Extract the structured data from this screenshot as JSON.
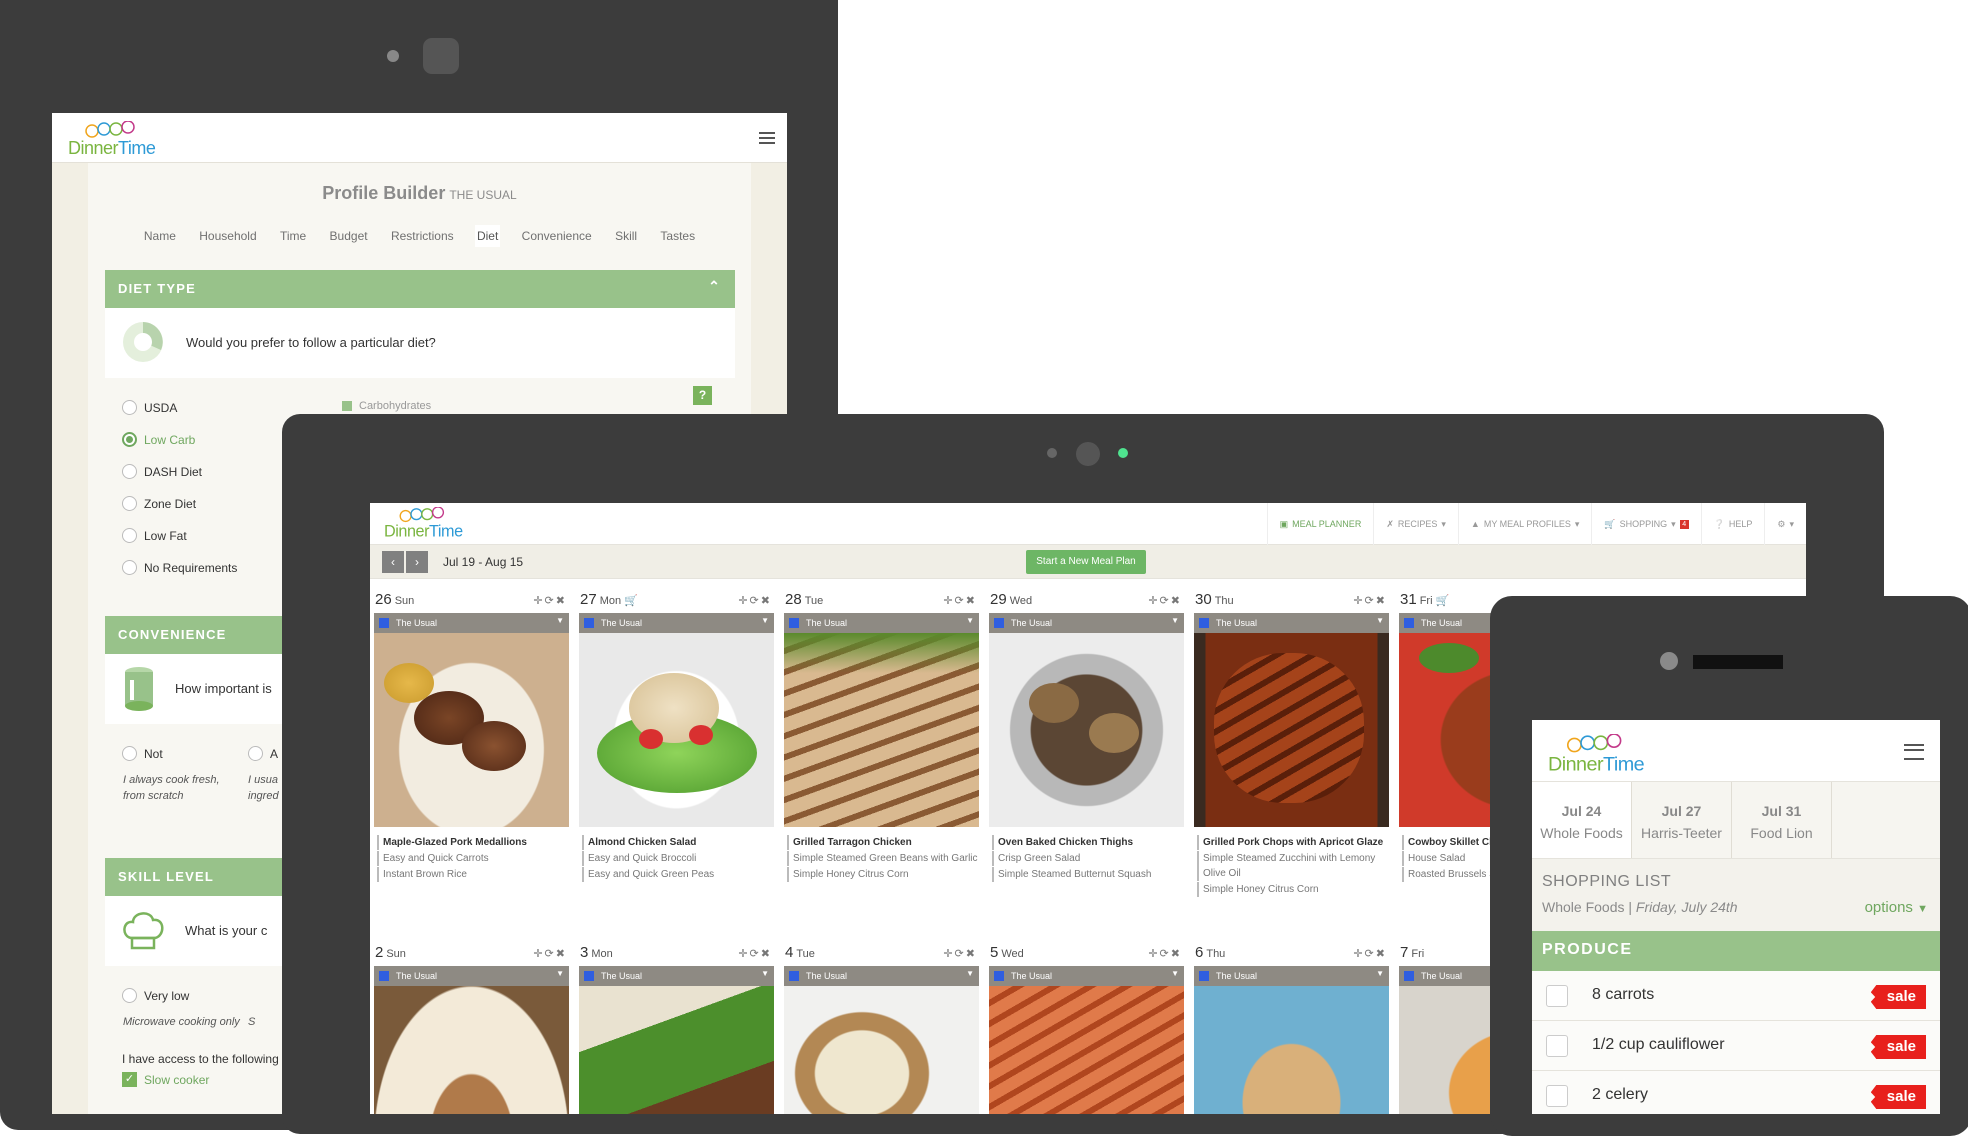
{
  "colors": {
    "brand_green": "#6fa75f",
    "section_green": "#98c28a",
    "sale_red": "#e8201c",
    "profile_blue": "#2f5ee0"
  },
  "logo": {
    "part1": "Dinner",
    "part2": "Time"
  },
  "tablet": {
    "title": "Profile Builder",
    "subtitle": "THE USUAL",
    "tabs": [
      "Name",
      "Household",
      "Time",
      "Budget",
      "Restrictions",
      "Diet",
      "Convenience",
      "Skill",
      "Tastes"
    ],
    "active_tab": "Diet",
    "diet": {
      "header": "DIET TYPE",
      "question": "Would you prefer to follow a particular diet?",
      "help": "?",
      "chart_label": "Carbohydrates",
      "options": [
        "USDA",
        "Low Carb",
        "DASH Diet",
        "Zone Diet",
        "Low Fat",
        "No Requirements"
      ],
      "selected": "Low Carb"
    },
    "convenience": {
      "header": "CONVENIENCE",
      "question": "How important is",
      "opt1": "Not",
      "opt2": "A",
      "note1a": "I always cook fresh,",
      "note1b": "from scratch",
      "note2a": "I usua",
      "note2b": "ingred"
    },
    "skill": {
      "header": "SKILL LEVEL",
      "question": "What is your c",
      "opt1": "Very low",
      "note1": "Microwave cooking only",
      "note2": "S",
      "access": "I have access to the following",
      "slow": "Slow cooker"
    }
  },
  "laptop": {
    "menu": [
      "MEAL PLANNER",
      "RECIPES",
      "MY MEAL PROFILES",
      "SHOPPING",
      "HELP"
    ],
    "shopping_badge": "4",
    "date_range": "Jul 19 - Aug 15",
    "new_plan": "Start a New Meal Plan",
    "profile_name": "The Usual",
    "week1": [
      {
        "num": "26",
        "dow": "Sun",
        "main": "Maple-Glazed Pork Medallions",
        "sides": [
          "Easy and Quick Carrots",
          "Instant Brown Rice"
        ]
      },
      {
        "num": "27",
        "dow": "Mon",
        "main": "Almond Chicken Salad",
        "sides": [
          "Easy and Quick Broccoli",
          "Easy and Quick Green Peas"
        ]
      },
      {
        "num": "28",
        "dow": "Tue",
        "main": "Grilled Tarragon Chicken",
        "sides": [
          "Simple Steamed Green Beans with Garlic",
          "Simple Honey Citrus Corn"
        ]
      },
      {
        "num": "29",
        "dow": "Wed",
        "main": "Oven Baked Chicken Thighs",
        "sides": [
          "Crisp Green Salad",
          "Simple Steamed Butternut Squash"
        ]
      },
      {
        "num": "30",
        "dow": "Thu",
        "main": "Grilled Pork Chops with Apricot Glaze",
        "sides": [
          "Simple Steamed Zucchini with Lemony Olive Oil",
          "Simple Honey Citrus Corn"
        ]
      },
      {
        "num": "31",
        "dow": "Fri",
        "main": "Cowboy Skillet Ch",
        "sides": [
          "House Salad",
          "Roasted Brussels S"
        ]
      }
    ],
    "week2": [
      {
        "num": "2",
        "dow": "Sun"
      },
      {
        "num": "3",
        "dow": "Mon"
      },
      {
        "num": "4",
        "dow": "Tue"
      },
      {
        "num": "5",
        "dow": "Wed"
      },
      {
        "num": "6",
        "dow": "Thu"
      },
      {
        "num": "7",
        "dow": "Fri"
      }
    ]
  },
  "phone": {
    "tabs": [
      {
        "date": "Jul 24",
        "store": "Whole Foods"
      },
      {
        "date": "Jul 27",
        "store": "Harris-Teeter"
      },
      {
        "date": "Jul 31",
        "store": "Food Lion"
      }
    ],
    "list_title": "SHOPPING LIST",
    "store": "Whole Foods",
    "separator": "|",
    "date": "Friday, July 24th",
    "options": "options",
    "section": "PRODUCE",
    "items": [
      "8 carrots",
      "1/2 cup cauliflower",
      "2 celery"
    ],
    "sale_label": "sale"
  }
}
